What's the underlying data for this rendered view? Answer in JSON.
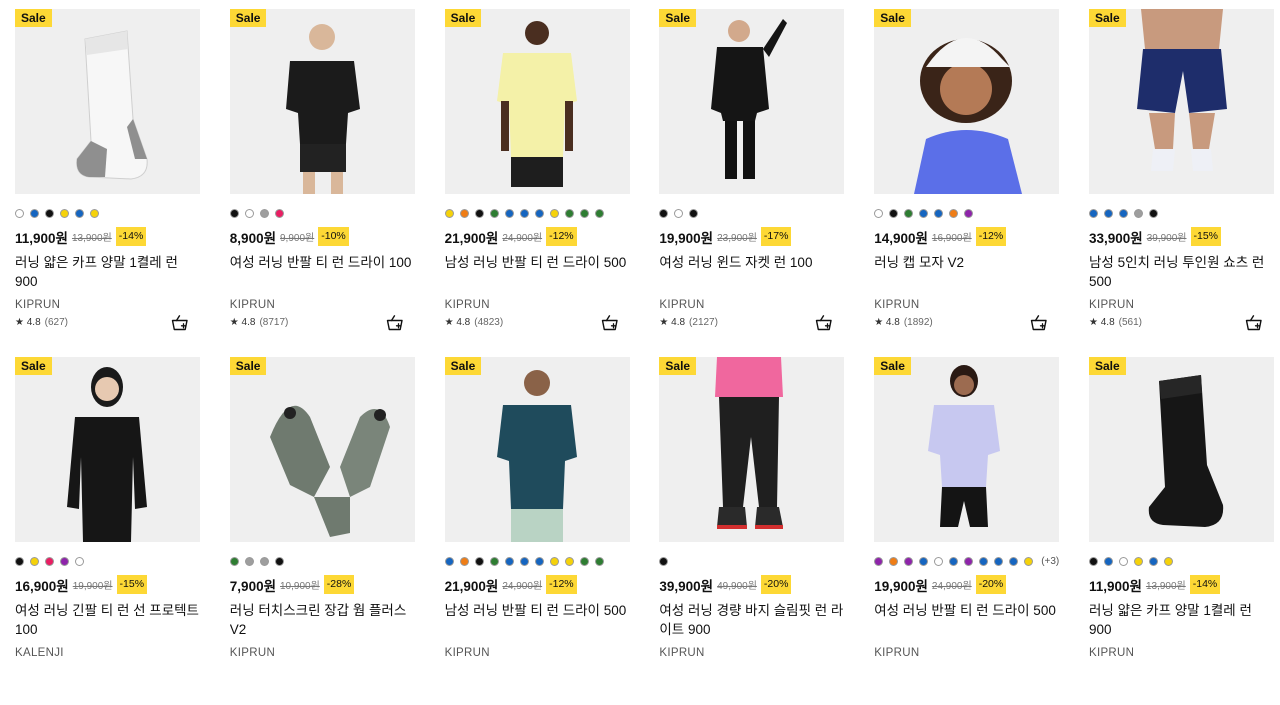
{
  "sale_label": "Sale",
  "products": [
    {
      "image": "sock-white-crew",
      "colors": [
        "#ffffff",
        "#1565c0",
        "#111111",
        "#f5d20a",
        "#1565c0",
        "#f5d20a"
      ],
      "colors_more": "",
      "price": "11,900원",
      "old_price": "13,900원",
      "discount": "-14%",
      "name": "러닝 얇은 카프 양말 1켤레 런 900",
      "brand": "KIPRUN",
      "rating": "★ 4.8",
      "reviews": "(627)"
    },
    {
      "image": "woman-black-tshirt",
      "colors": [
        "#111111",
        "#ffffff",
        "#9e9e9e",
        "#e91e63"
      ],
      "colors_more": "",
      "price": "8,900원",
      "old_price": "9,900원",
      "discount": "-10%",
      "name": "여성 러닝 반팔 티 런 드라이 100",
      "brand": "KIPRUN",
      "rating": "★ 4.8",
      "reviews": "(8717)"
    },
    {
      "image": "man-yellow-tshirt",
      "colors": [
        "#f5d20a",
        "#ef7d16",
        "#111111",
        "#2e7d32",
        "#1565c0",
        "#1565c0",
        "#1565c0",
        "#f5d20a",
        "#2e7d32",
        "#2e7d32",
        "#2e7d32"
      ],
      "colors_more": "",
      "price": "21,900원",
      "old_price": "24,900원",
      "discount": "-12%",
      "name": "남성 러닝 반팔 티 런 드라이 500",
      "brand": "KIPRUN",
      "rating": "★ 4.8",
      "reviews": "(4823)"
    },
    {
      "image": "woman-black-jacket",
      "colors": [
        "#111111",
        "#ffffff",
        "#111111"
      ],
      "colors_more": "",
      "price": "19,900원",
      "old_price": "23,900원",
      "discount": "-17%",
      "name": "여성 러닝 윈드 자켓 런 100",
      "brand": "KIPRUN",
      "rating": "★ 4.8",
      "reviews": "(2127)"
    },
    {
      "image": "woman-white-cap",
      "colors": [
        "#ffffff",
        "#111111",
        "#2e7d32",
        "#1565c0",
        "#1565c0",
        "#ef7d16",
        "#8e24aa"
      ],
      "colors_more": "",
      "price": "14,900원",
      "old_price": "16,900원",
      "discount": "-12%",
      "name": "러닝 캡 모자 V2",
      "brand": "KIPRUN",
      "rating": "★ 4.8",
      "reviews": "(1892)"
    },
    {
      "image": "man-navy-shorts",
      "colors": [
        "#1565c0",
        "#1565c0",
        "#1565c0",
        "#9e9e9e",
        "#111111"
      ],
      "colors_more": "",
      "price": "33,900원",
      "old_price": "39,900원",
      "discount": "-15%",
      "name": "남성 5인치 러닝 투인원 쇼츠 런 500",
      "brand": "KIPRUN",
      "rating": "★ 4.8",
      "reviews": "(561)"
    },
    {
      "image": "woman-black-longsleeve",
      "colors": [
        "#111111",
        "#f5d20a",
        "#e91e63",
        "#8e24aa",
        "#ffffff"
      ],
      "colors_more": "",
      "price": "16,900원",
      "old_price": "19,900원",
      "discount": "-15%",
      "name": "여성 러닝 긴팔 티 런 선 프로텍트 100",
      "brand": "KALENJI",
      "rating": "",
      "reviews": ""
    },
    {
      "image": "grey-touch-gloves",
      "colors": [
        "#2e7d32",
        "#9e9e9e",
        "#9e9e9e",
        "#111111"
      ],
      "colors_more": "",
      "price": "7,900원",
      "old_price": "10,900원",
      "discount": "-28%",
      "name": "러닝 터치스크린 장갑 웜 플러스 V2",
      "brand": "KIPRUN",
      "rating": "",
      "reviews": ""
    },
    {
      "image": "man-teal-tshirt",
      "colors": [
        "#1565c0",
        "#ef7d16",
        "#111111",
        "#2e7d32",
        "#1565c0",
        "#1565c0",
        "#1565c0",
        "#f5d20a",
        "#f5d20a",
        "#2e7d32",
        "#2e7d32"
      ],
      "colors_more": "",
      "price": "21,900원",
      "old_price": "24,900원",
      "discount": "-12%",
      "name": "남성 러닝 반팔 티 런 드라이 500",
      "brand": "KIPRUN",
      "rating": "",
      "reviews": ""
    },
    {
      "image": "woman-black-pants",
      "colors": [
        "#111111"
      ],
      "colors_more": "",
      "price": "39,900원",
      "old_price": "49,900원",
      "discount": "-20%",
      "name": "여성 러닝 경량 바지 슬림핏 런 라이트 900",
      "brand": "KIPRUN",
      "rating": "",
      "reviews": ""
    },
    {
      "image": "woman-lavender-tshirt",
      "colors": [
        "#8e24aa",
        "#ef7d16",
        "#8e24aa",
        "#1565c0",
        "#ffffff",
        "#1565c0",
        "#8e24aa",
        "#1565c0",
        "#1565c0",
        "#1565c0",
        "#f5d20a"
      ],
      "colors_more": "(+3)",
      "price": "19,900원",
      "old_price": "24,900원",
      "discount": "-20%",
      "name": "여성 러닝 반팔 티 런 드라이 500",
      "brand": "KIPRUN",
      "rating": "",
      "reviews": ""
    },
    {
      "image": "sock-black-crew",
      "colors": [
        "#111111",
        "#1565c0",
        "#ffffff",
        "#f5d20a",
        "#1565c0",
        "#f5d20a"
      ],
      "colors_more": "",
      "price": "11,900원",
      "old_price": "13,900원",
      "discount": "-14%",
      "name": "러닝 얇은 카프 양말 1켤레 런 900",
      "brand": "KIPRUN",
      "rating": "",
      "reviews": ""
    }
  ]
}
